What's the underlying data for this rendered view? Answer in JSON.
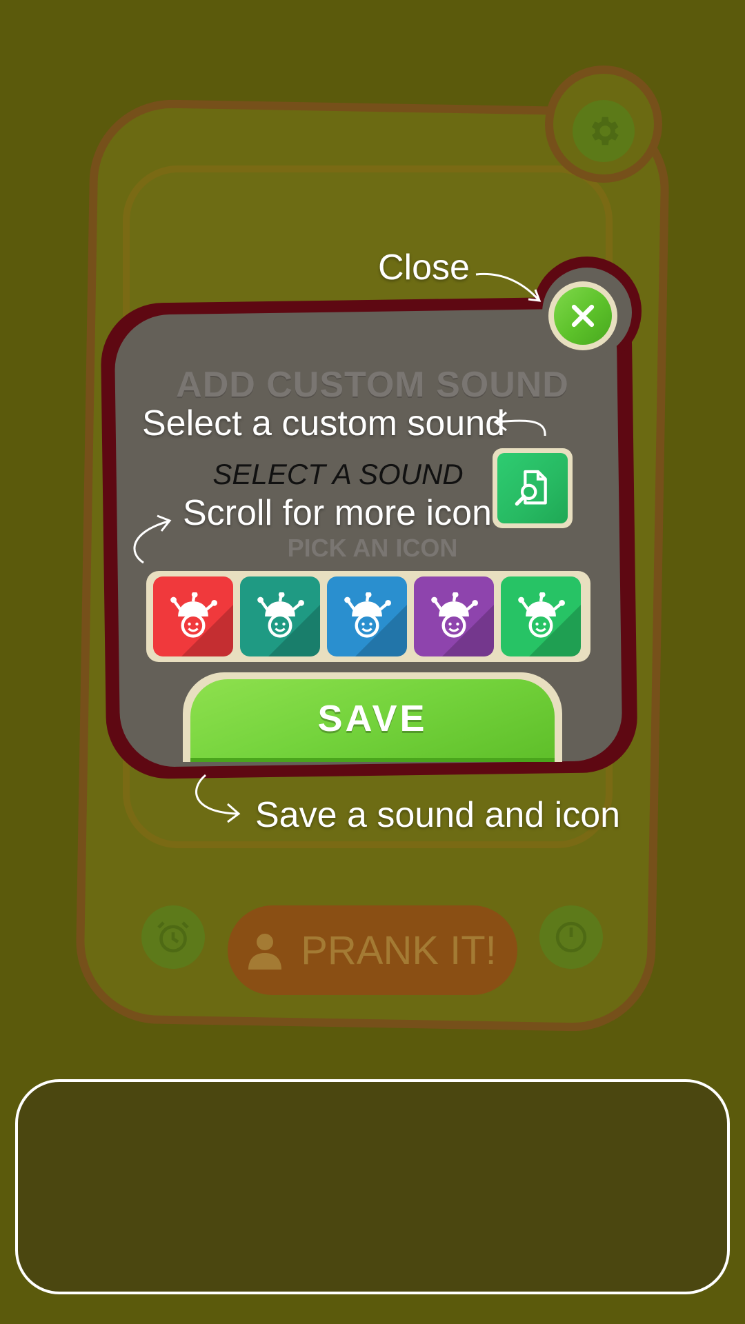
{
  "background_app": {
    "prank_label": "PRANK IT!",
    "settings_icon": "gear-icon",
    "left_icon": "alarm-clock-icon",
    "right_icon": "timer-icon"
  },
  "dialog": {
    "title": "ADD CUSTOM SOUND",
    "select_sound_label": "SELECT A SOUND",
    "pick_icon_label": "PICK AN ICON",
    "save_label": "SAVE",
    "browse_icon": "file-search-icon",
    "close_icon": "close-icon",
    "icons": [
      {
        "name": "jester-icon",
        "color": "#f0393c"
      },
      {
        "name": "jester-icon",
        "color": "#1f9a83"
      },
      {
        "name": "jester-icon",
        "color": "#2a8fcf"
      },
      {
        "name": "jester-icon",
        "color": "#8e44ad"
      },
      {
        "name": "jester-icon",
        "color": "#27c365"
      }
    ]
  },
  "tutorial": {
    "close": "Close",
    "select_custom": "Select a custom sound",
    "scroll_more": "Scroll for more icon",
    "save_hint": "Save a sound and icon"
  },
  "colors": {
    "overlay_bg": "#5b5a0c",
    "dialog_border": "#5e0812",
    "dialog_fill": "#646058",
    "save_green": "#74d33c",
    "accent_cream": "#e8dfc0"
  }
}
